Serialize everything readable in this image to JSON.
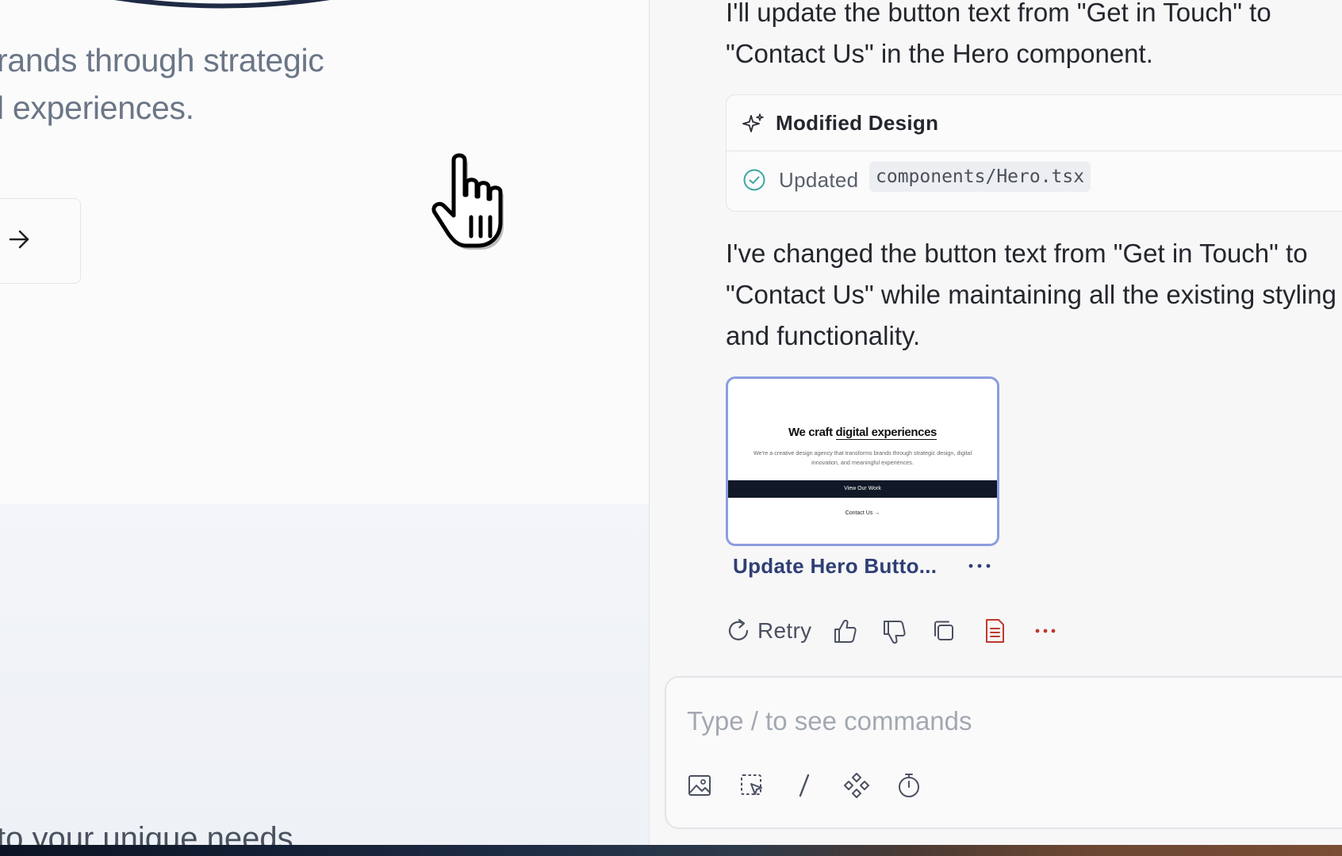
{
  "preview": {
    "hero_text": "rands through strategic\nl experiences.",
    "bottom_text": "to your unique needs"
  },
  "chat": {
    "message_1": "I'll update the button text from \"Get in Touch\" to \"Contact Us\" in the Hero component.",
    "card": {
      "title": "Modified Design",
      "status": "Updated",
      "file": "components/Hero.tsx"
    },
    "message_2": "I've changed the button text from \"Get in Touch\" to \"Contact Us\" while maintaining all the existing styling and functionality.",
    "thumbnail": {
      "title_plain": "We craft ",
      "title_underlined": "digital experiences",
      "subtitle": "We're a creative design agency that transforms brands through strategic design, digital innovation, and meaningful experiences.",
      "primary_button": "View Our Work",
      "secondary_button": "Contact Us →",
      "caption": "Update Hero Butto..."
    },
    "actions": {
      "retry_label": "Retry"
    },
    "composer": {
      "placeholder": "Type / to see commands"
    }
  },
  "colors": {
    "accent_border": "#8c9ddf",
    "caption": "#2f3f74",
    "success": "#3aa6a0",
    "danger": "#c0392b"
  }
}
